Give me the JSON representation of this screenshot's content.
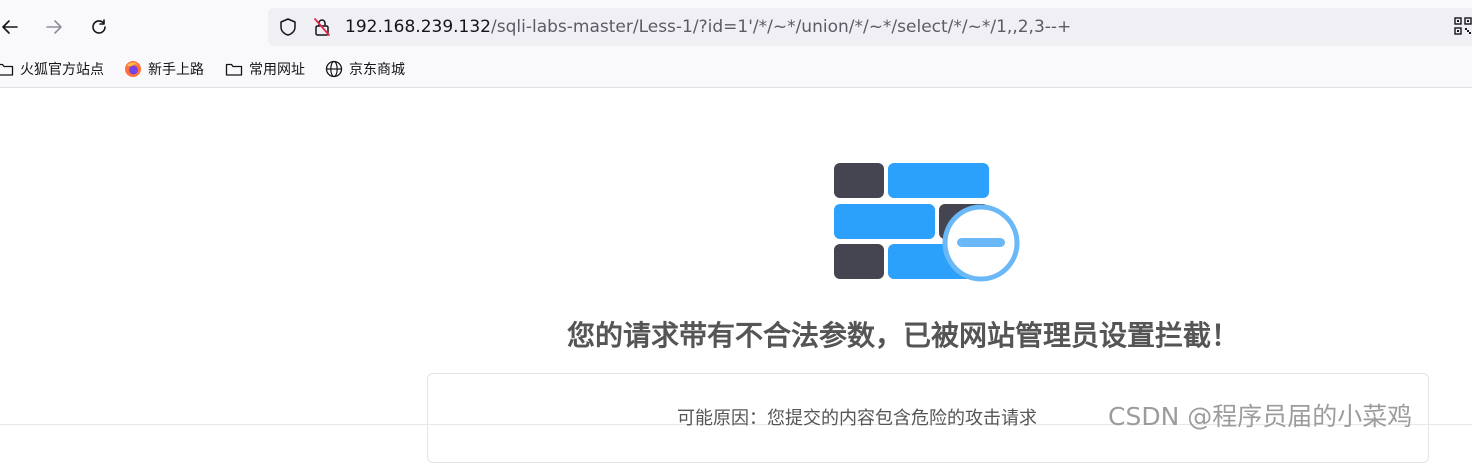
{
  "browser": {
    "url_host": "192.168.239.132",
    "url_path": "/sqli-labs-master/Less-1/?id=1'/*/~*/union/*/~*/select/*/~*/1,,2,3--+",
    "bookmarks": [
      {
        "label": "火狐官方站点",
        "icon": "folder-icon"
      },
      {
        "label": "新手上路",
        "icon": "firefox-icon"
      },
      {
        "label": "常用网址",
        "icon": "folder-icon"
      },
      {
        "label": "京东商城",
        "icon": "globe-icon"
      }
    ]
  },
  "page": {
    "title": "您的请求带有不合法参数，已被网站管理员设置拦截！",
    "reason": "可能原因：您提交的内容包含危险的攻击请求"
  },
  "watermark": "CSDN @程序员届的小菜鸡",
  "colors": {
    "wall_blue": "#2ba1fb",
    "wall_dark": "#454552",
    "circle_stroke": "#6ab8f7",
    "title": "#555555"
  }
}
